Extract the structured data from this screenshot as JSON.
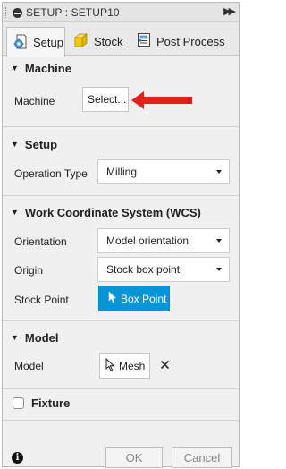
{
  "window": {
    "title": "SETUP : SETUP10"
  },
  "tabs": [
    {
      "label": "Setup",
      "icon": "gear-document-icon",
      "active": true
    },
    {
      "label": "Stock",
      "icon": "stock-cube-icon",
      "active": false
    },
    {
      "label": "Post Process",
      "icon": "post-process-icon",
      "active": false
    }
  ],
  "machine": {
    "header": "Machine",
    "label": "Machine",
    "button_label": "Select..."
  },
  "setup": {
    "header": "Setup",
    "operation_type_label": "Operation Type",
    "operation_type_value": "Milling"
  },
  "wcs": {
    "header": "Work Coordinate System (WCS)",
    "orientation_label": "Orientation",
    "orientation_value": "Model orientation",
    "origin_label": "Origin",
    "origin_value": "Stock box point",
    "stock_point_label": "Stock Point",
    "stock_point_button": "Box Point"
  },
  "model": {
    "header": "Model",
    "label": "Model",
    "button_label": "Mesh"
  },
  "fixture": {
    "label": "Fixture",
    "checked": false
  },
  "footer": {
    "ok_label": "OK",
    "cancel_label": "Cancel"
  },
  "colors": {
    "accent_blue": "#0696d7",
    "annotation_red": "#e0201b"
  }
}
